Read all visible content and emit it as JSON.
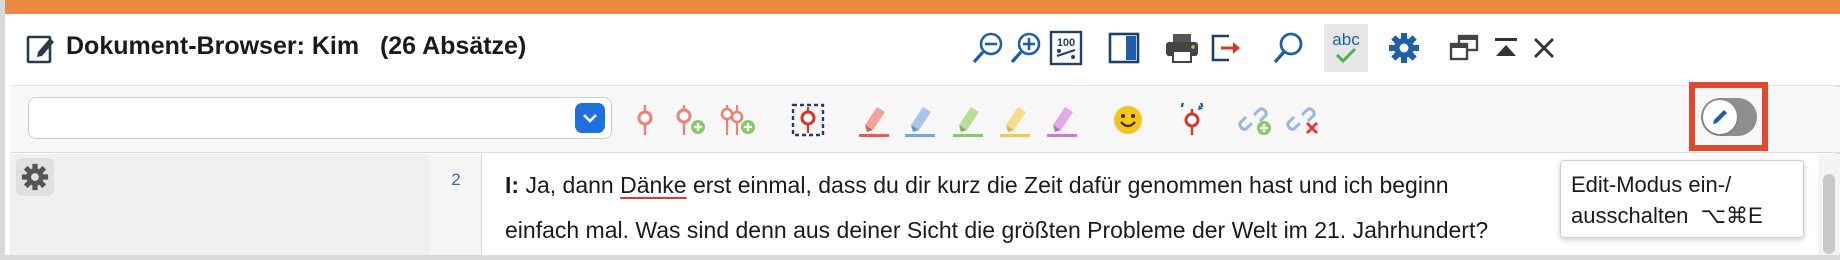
{
  "window": {
    "title": "Dokument-Browser: Kim",
    "paragraph_count": "(26 Absätze)",
    "accent_color": "#ec8a45"
  },
  "titlebar_icons": [
    "zoom-out-icon",
    "zoom-in-icon",
    "zoom-100-icon",
    "split-view-icon",
    "print-icon",
    "export-icon",
    "search-icon",
    "spellcheck-icon",
    "settings-icon",
    "detach-window-icon",
    "collapse-icon",
    "close-icon"
  ],
  "spellcheck_label": "abc",
  "zoom_100_label": "100",
  "toolbar": {
    "code_dropdown_value": "",
    "icons": [
      "code-icon",
      "code-add-icon",
      "code-multi-add-icon",
      "code-region-icon",
      "highlight-red-icon",
      "highlight-blue-icon",
      "highlight-green-icon",
      "highlight-yellow-icon",
      "highlight-purple-icon",
      "emoticode-icon",
      "code-favorite-icon",
      "link-add-icon",
      "link-remove-icon"
    ],
    "edit_mode_toggle_on": false,
    "highlight_color": "#e0492d"
  },
  "document": {
    "line_number": "2",
    "speaker": "I:",
    "line1_pre": " Ja, dann ",
    "line1_flagged": "Dänke",
    "line1_post": " erst einmal, dass du dir kurz die Zeit dafür genommen hast und ich beginn",
    "line2": "einfach mal. Was sind denn aus deiner Sicht die größten Probleme der Welt im 21. Jahrhundert?"
  },
  "tooltip": {
    "line1": "Edit-Modus ein-/",
    "line2": "ausschalten  ⌥⌘E"
  }
}
